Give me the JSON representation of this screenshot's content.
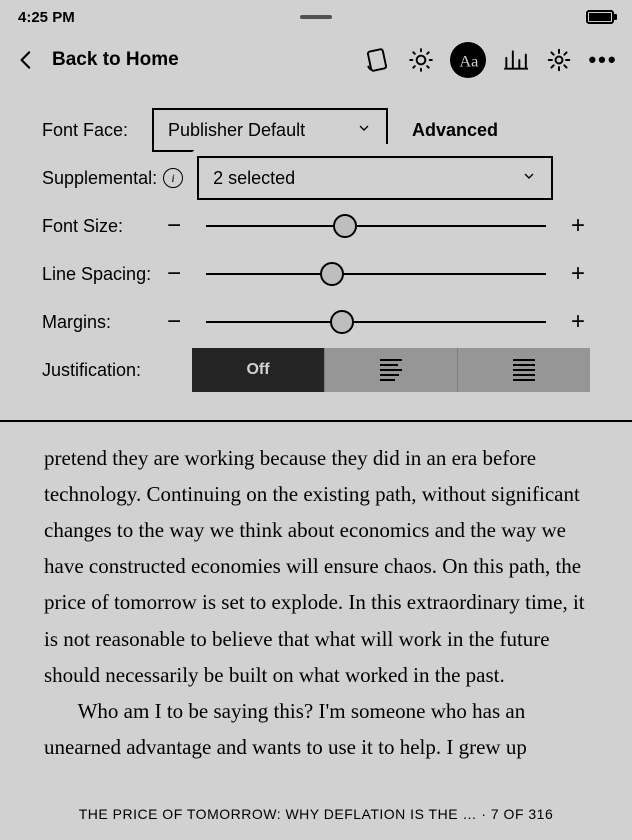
{
  "status": {
    "time": "4:25 PM"
  },
  "header": {
    "back_label": "Back to Home"
  },
  "settings": {
    "font_face_label": "Font Face:",
    "font_face_value": "Publisher Default",
    "advanced_label": "Advanced",
    "supplemental_label": "Supplemental:",
    "supplemental_value": "2 selected",
    "font_size_label": "Font Size:",
    "line_spacing_label": "Line Spacing:",
    "margins_label": "Margins:",
    "justification_label": "Justification:",
    "justification_off": "Off",
    "sliders": {
      "font_size_pct": 41,
      "line_spacing_pct": 37,
      "margins_pct": 40
    }
  },
  "reader": {
    "para1": "pretend they are working because they did in an era before technology. Continuing on the existing path, without significant changes to the way we think about economics and the way we have constructed economies will ensure chaos. On this path, the price of tomorrow is set to explode. In this extraordinary time, it is not reasonable to believe that what will work in the future should necessarily be built on what worked in the past.",
    "para2": "Who am I to be saying this? I'm someone who has an unearned advantage and wants to use it to help. I grew up"
  },
  "footer": {
    "text": "THE PRICE OF TOMORROW: WHY DEFLATION IS THE … · 7 OF 316"
  }
}
